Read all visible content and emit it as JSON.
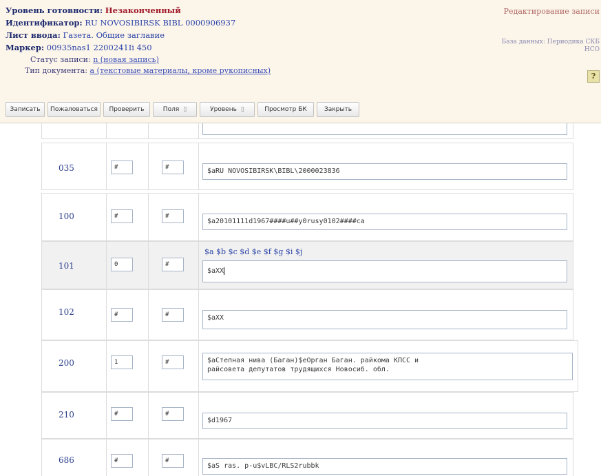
{
  "header": {
    "level_label": "Уровень готовности:",
    "level_value": "Незаконченный",
    "id_label": "Идентификатор:",
    "id_value": "RU NOVOSIBIRSK BIBL 0000906937",
    "sheet_label": "Лист ввода:",
    "sheet_value": "Газета. Общие заглавие",
    "marker_label": "Маркер:",
    "marker_value": "00935nas1 2200241Ii 450",
    "status_label": "Статус записи:",
    "status_value": "n (новая запись)",
    "doctype_label": "Тип документа:",
    "doctype_value": "a (текстовые материалы, кроме рукописных)",
    "right_title": "Редактирование записи",
    "right_db_line1": "База данных: Периодика СКБ",
    "right_db_line2": "НСО",
    "help_icon": "?"
  },
  "toolbar": {
    "save": "Записать",
    "complain": "Пожаловаться",
    "check": "Проверить",
    "fields": "Поля",
    "level": "Уровень",
    "preview": "Просмотр БК",
    "close": "Закрыть"
  },
  "rows": [
    {
      "tag": "035",
      "ind1": "#",
      "ind2": "#",
      "value": "$aRU NOVOSIBIRSK\\BIBL\\2000023836"
    },
    {
      "tag": "100",
      "ind1": "#",
      "ind2": "#",
      "value": "$a20101111d1967####u##y0rusy0102####ca"
    },
    {
      "tag": "101",
      "ind1": "0",
      "ind2": "#",
      "value": "$aXX",
      "subfields": "$a $b $c $d $e $f $g $i $j"
    },
    {
      "tag": "102",
      "ind1": "#",
      "ind2": "#",
      "value": "$aXX"
    },
    {
      "tag": "200",
      "ind1": "1",
      "ind2": "#",
      "value": "$aСтепная нива (Баган)$eОрган Баган. райкома КПСС и\nрайсовета депутатов трудящихся Новосиб. обл."
    },
    {
      "tag": "210",
      "ind1": "#",
      "ind2": "#",
      "value": "$d1967"
    },
    {
      "tag": "686",
      "ind1": "#",
      "ind2": "#",
      "value": "$aS ras. p-u$vLBC/RLS2rubbk"
    }
  ]
}
